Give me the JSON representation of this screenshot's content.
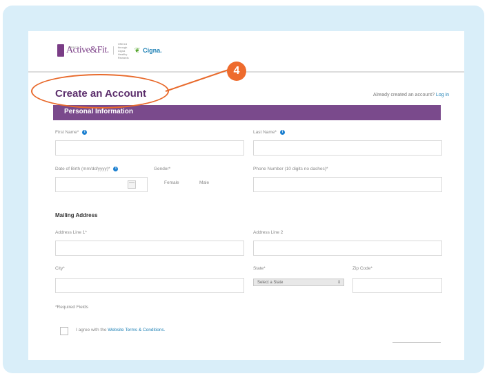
{
  "header": {
    "brand": "Active&Fit.",
    "brand_sub": "DIRECT",
    "partner_small": "Offered through Cigna Healthy Rewards",
    "partner": "Cigna."
  },
  "form": {
    "title": "Create an Account",
    "already_text": "Already created an account?",
    "login_link": "Log in",
    "section_banner": "Personal Information",
    "first_name_label": "First Name*",
    "last_name_label": "Last Name*",
    "dob_label": "Date of Birth (mm/dd/yyyy)*",
    "gender_label": "Gender*",
    "gender_female": "Female",
    "gender_male": "Male",
    "phone_label": "Phone Number (10 digits no dashes)*",
    "mailing_heading": "Mailing Address",
    "address1_label": "Address Line 1*",
    "address2_label": "Address Line 2",
    "city_label": "City*",
    "state_label": "State*",
    "state_value": "Select a State",
    "zip_label": "Zip Code*",
    "required_note": "*Required Fields",
    "agree_text": "I agree with the",
    "terms_link": "Website Terms & Conditions."
  },
  "annotation": {
    "step_number": "4",
    "color": "#ee6b2d"
  }
}
